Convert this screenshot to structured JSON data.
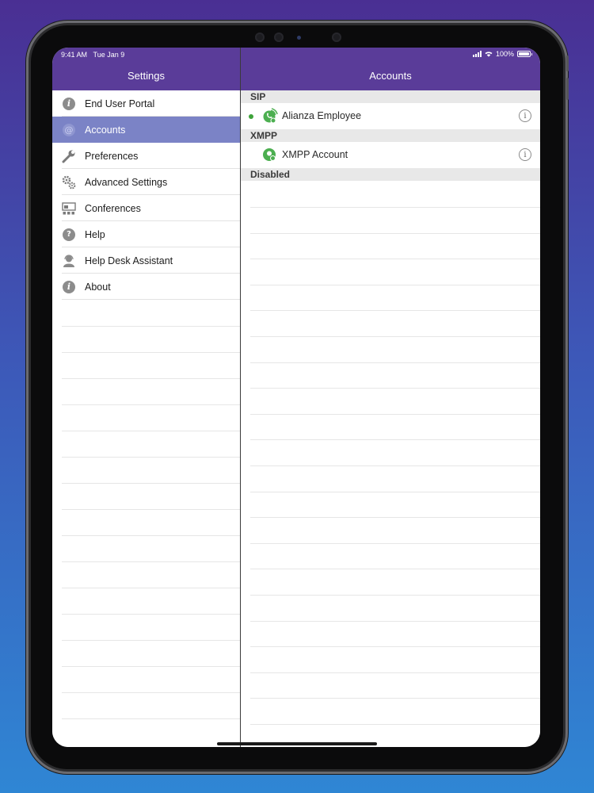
{
  "status_bar": {
    "time": "9:41 AM",
    "date": "Tue Jan 9",
    "battery": "100%"
  },
  "master": {
    "title": "Settings",
    "items": [
      {
        "label": "End User Portal",
        "icon": "info-icon",
        "selected": false
      },
      {
        "label": "Accounts",
        "icon": "at-icon",
        "selected": true
      },
      {
        "label": "Preferences",
        "icon": "wrench-icon",
        "selected": false
      },
      {
        "label": "Advanced Settings",
        "icon": "gears-icon",
        "selected": false
      },
      {
        "label": "Conferences",
        "icon": "conference-icon",
        "selected": false
      },
      {
        "label": "Help",
        "icon": "help-icon",
        "selected": false
      },
      {
        "label": "Help Desk Assistant",
        "icon": "headset-icon",
        "selected": false
      },
      {
        "label": "About",
        "icon": "info-icon",
        "selected": false
      }
    ]
  },
  "detail": {
    "title": "Accounts",
    "sections": [
      {
        "header": "SIP",
        "rows": [
          {
            "label": "Alianza Employee",
            "registered": true,
            "icon": "sip-account-icon"
          }
        ]
      },
      {
        "header": "XMPP",
        "rows": [
          {
            "label": "XMPP Account",
            "registered": false,
            "icon": "xmpp-account-icon"
          }
        ]
      },
      {
        "header": "Disabled",
        "rows": []
      }
    ]
  },
  "colors": {
    "header": "#5a3c99",
    "selected_row": "#7b83c6",
    "status_dot": "#3ea33a",
    "account_icon": "#4caf50"
  }
}
